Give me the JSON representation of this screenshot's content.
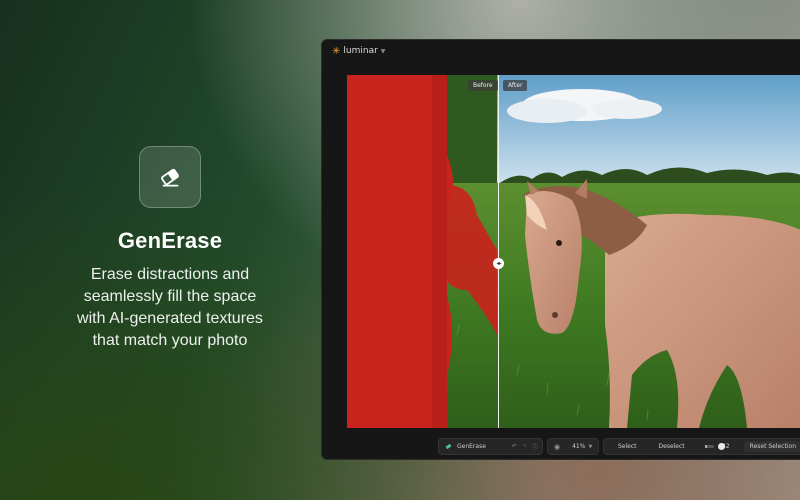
{
  "promo": {
    "icon": "eraser-icon",
    "title": "GenErase",
    "description": "Erase distractions and\nseamlessly fill the space\nwith AI-generated textures\nthat match your photo"
  },
  "app": {
    "name": "luminar",
    "logo_icon": "sun-icon",
    "menu_icon": "chevron-down-icon"
  },
  "canvas": {
    "before_label": "Before",
    "after_label": "After",
    "divider_position": 0.33,
    "mask_color": "#c8241d"
  },
  "toolbar": {
    "tool_name": "GenErase",
    "undo_icon": "undo-icon",
    "redo_icon": "redo-icon",
    "info_icon": "info-icon",
    "eye_icon": "eye-icon",
    "zoom": "41%",
    "select_label": "Select",
    "deselect_label": "Deselect",
    "brush_size": "32",
    "brush_fraction": 0.3,
    "reset_label": "Reset Selection"
  },
  "colors": {
    "accent": "#f0a43a",
    "window_bg": "#161616",
    "mask": "#c8241d"
  }
}
